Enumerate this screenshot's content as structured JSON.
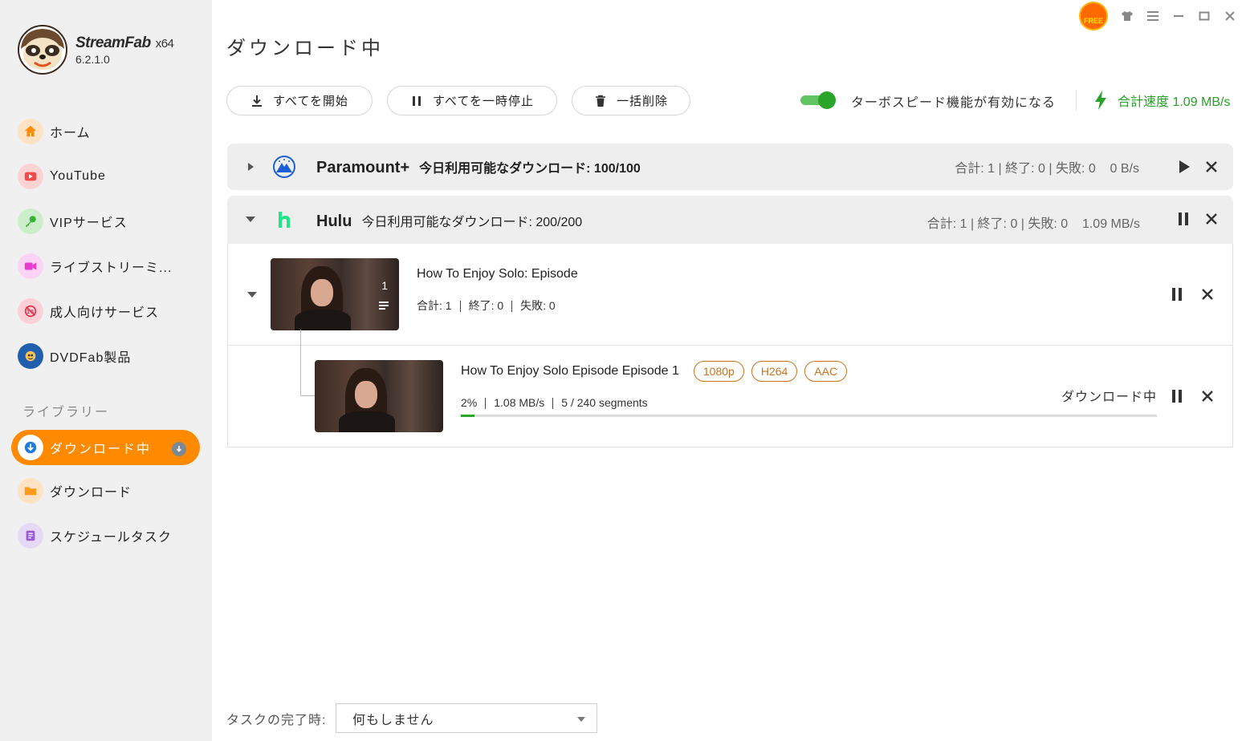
{
  "app": {
    "name": "StreamFab",
    "arch": "x64",
    "version": "6.2.1.0"
  },
  "topbar": {
    "free_badge": "FREE"
  },
  "sidebar": {
    "items": [
      {
        "label": "ホーム",
        "icon": "home-icon"
      },
      {
        "label": "YouTube",
        "icon": "youtube-icon"
      },
      {
        "label": "VIPサービス",
        "icon": "key-icon"
      },
      {
        "label": "ライブストリーミ...",
        "icon": "video-camera-icon"
      },
      {
        "label": "成人向けサービス",
        "icon": "adult-icon"
      },
      {
        "label": "DVDFab製品",
        "icon": "dvdfab-icon"
      }
    ],
    "library_label": "ライブラリー",
    "library": [
      {
        "label": "ダウンロード中",
        "icon": "download-icon",
        "active": true
      },
      {
        "label": "ダウンロード",
        "icon": "folder-icon"
      },
      {
        "label": "スケジュールタスク",
        "icon": "schedule-icon"
      }
    ]
  },
  "page": {
    "title": "ダウンロード中"
  },
  "toolbar": {
    "start_all": "すべてを開始",
    "pause_all": "すべてを一時停止",
    "delete_all": "一括削除",
    "turbo_label": "ターボスピード機能が有効になる",
    "turbo_enabled": true,
    "total_speed": "合計速度 1.09 MB/s"
  },
  "groups": [
    {
      "name": "Paramount+",
      "available": "今日利用可能なダウンロード: 100/100",
      "stats": "合計: 1 | 終了: 0 | 失敗: 0    0 B/s",
      "expanded": false
    },
    {
      "name": "Hulu",
      "available": "今日利用可能なダウンロード: 200/200",
      "stats": "合計: 1 | 終了: 0 | 失敗: 0    1.09 MB/s",
      "expanded": true,
      "series": {
        "title": "How To Enjoy Solo: Episode",
        "count": "1",
        "total": "合計: 1",
        "done": "終了: 0",
        "failed": "失敗: 0"
      },
      "episode": {
        "title": "How To Enjoy Solo Episode Episode 1",
        "tags": [
          "1080p",
          "H264",
          "AAC"
        ],
        "percent_text": "2%",
        "progress": 0.02,
        "speed": "1.08 MB/s",
        "segments": "5 / 240 segments",
        "status": "ダウンロード中"
      }
    }
  ],
  "footer": {
    "label": "タスクの完了時:",
    "select_value": "何もしません"
  },
  "colors": {
    "accent": "#ff8a00",
    "green": "#2aa52a",
    "tag": "#c8731b"
  }
}
